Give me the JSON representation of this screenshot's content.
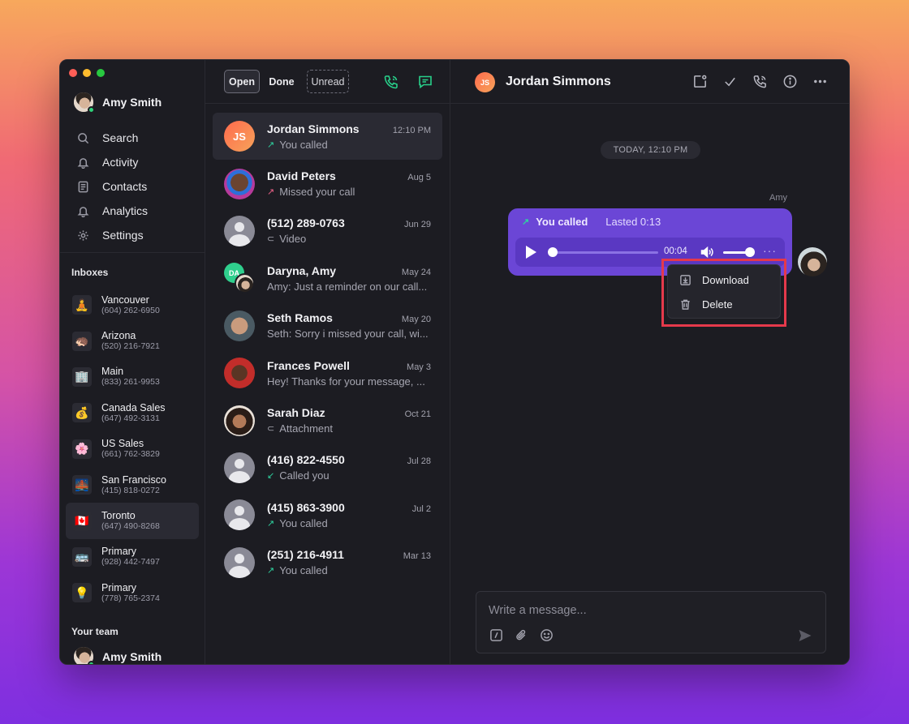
{
  "user": {
    "name": "Amy Smith"
  },
  "nav": [
    {
      "label": "Search",
      "icon": "search-icon"
    },
    {
      "label": "Activity",
      "icon": "bell-icon"
    },
    {
      "label": "Contacts",
      "icon": "contacts-icon"
    },
    {
      "label": "Analytics",
      "icon": "bell-icon"
    },
    {
      "label": "Settings",
      "icon": "gear-icon"
    }
  ],
  "inboxes_title": "Inboxes",
  "inboxes": [
    {
      "emoji": "🧘",
      "name": "Vancouver",
      "number": "(604) 262-6950"
    },
    {
      "emoji": "🦔",
      "name": "Arizona",
      "number": "(520) 216-7921"
    },
    {
      "emoji": "🏢",
      "name": "Main",
      "number": "(833) 261-9953"
    },
    {
      "emoji": "💰",
      "name": "Canada Sales",
      "number": "(647) 492-3131"
    },
    {
      "emoji": "🌸",
      "name": "US Sales",
      "number": "(661) 762-3829"
    },
    {
      "emoji": "🌉",
      "name": "San Francisco",
      "number": "(415) 818-0272"
    },
    {
      "emoji": "🇨🇦",
      "name": "Toronto",
      "number": "(647) 490-8268"
    },
    {
      "emoji": "🚌",
      "name": "Primary",
      "number": "(928) 442-7497"
    },
    {
      "emoji": "💡",
      "name": "Primary",
      "number": "(778) 765-2374"
    }
  ],
  "team_title": "Your team",
  "team": [
    {
      "name": "Amy Smith"
    }
  ],
  "filters": {
    "open": "Open",
    "done": "Done",
    "unread": "Unread"
  },
  "conversations": [
    {
      "name": "Jordan Simmons",
      "initials": "JS",
      "time": "12:10 PM",
      "icon": "↗",
      "preview": "You called"
    },
    {
      "name": "David Peters",
      "time": "Aug 5",
      "icon": "↗",
      "preview": "Missed your call"
    },
    {
      "name": "(512) 289-0763",
      "time": "Jun 29",
      "icon": "⊂",
      "preview": "Video"
    },
    {
      "name": "Daryna, Amy",
      "initials": "DA",
      "time": "May 24",
      "preview": "Amy: Just a reminder on our call..."
    },
    {
      "name": "Seth Ramos",
      "time": "May 20",
      "preview": "Seth: Sorry i missed your call, wi..."
    },
    {
      "name": "Frances Powell",
      "time": "May 3",
      "preview": "Hey! Thanks for your message, ..."
    },
    {
      "name": "Sarah Diaz",
      "time": "Oct 21",
      "icon": "⊂",
      "preview": "Attachment"
    },
    {
      "name": "(416) 822-4550",
      "time": "Jul 28",
      "icon": "↙",
      "preview": "Called you"
    },
    {
      "name": "(415) 863-3900",
      "time": "Jul 2",
      "icon": "↗",
      "preview": "You called"
    },
    {
      "name": "(251) 216-4911",
      "time": "Mar 13",
      "icon": "↗",
      "preview": "You called"
    }
  ],
  "chat": {
    "initials": "JS",
    "title": "Jordan Simmons",
    "date_label": "TODAY, 12:10 PM",
    "sender": "Amy",
    "call": {
      "arrow": "↗",
      "label": "You called",
      "lasted": "Lasted 0:13"
    },
    "player": {
      "time": "00:04",
      "progress": 0.0,
      "volume": 1.0,
      "more": "···"
    },
    "menu": [
      {
        "label": "Download",
        "icon": "download-icon"
      },
      {
        "label": "Delete",
        "icon": "trash-icon"
      }
    ],
    "composer": {
      "placeholder": "Write a message..."
    }
  },
  "colors": {
    "accent": "#6b46d6",
    "green": "#28d08a",
    "highlight": "#e5394b"
  }
}
